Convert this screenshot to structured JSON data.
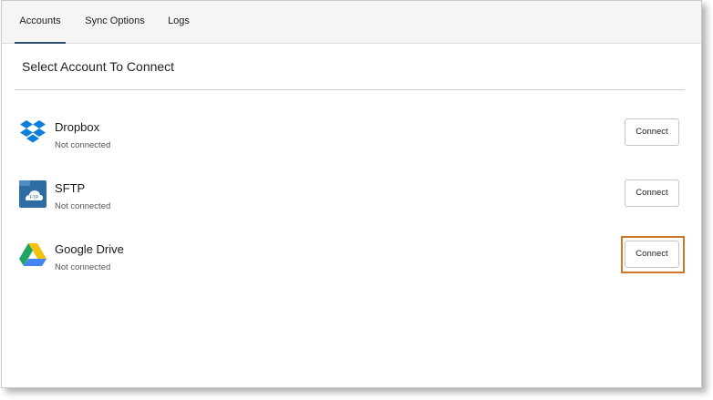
{
  "tabs": {
    "accounts_label": "Accounts",
    "sync_options_label": "Sync Options",
    "logs_label": "Logs",
    "active": "Accounts"
  },
  "main": {
    "section_title": "Select Account To Connect"
  },
  "accounts": [
    {
      "name": "Dropbox",
      "status": "Not connected",
      "button_label": "Connect",
      "icon": "dropbox-icon"
    },
    {
      "name": "SFTP",
      "status": "Not connected",
      "button_label": "Connect",
      "icon": "sftp-icon"
    },
    {
      "name": "Google Drive",
      "status": "Not connected",
      "button_label": "Connect",
      "icon": "google-drive-icon"
    }
  ],
  "colors": {
    "active_tab_underline": "#2f4f6f",
    "highlight": "#d2772a",
    "dropbox_blue": "#0d7fd8",
    "sftp_blue": "#2e6da4"
  }
}
